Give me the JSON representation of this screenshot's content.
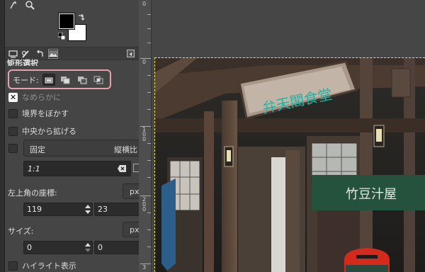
{
  "toolbox": {
    "tool_icons": [
      "path-tool-icon",
      "magnify-icon"
    ],
    "colors": {
      "foreground": "#000000",
      "background": "#ffffff"
    }
  },
  "dock_tabs": [
    "tool-options-icon",
    "paint-dynamics-icon",
    "undo-history-icon",
    "images-icon"
  ],
  "tool_options": {
    "title": "矩形選択",
    "mode_label": "モード:",
    "mode_buttons": [
      "replace",
      "add",
      "subtract",
      "intersect"
    ],
    "antialias_label": "なめらかに",
    "feather_label": "境界をぼかす",
    "expand_from_center_label": "中央から拡げる",
    "fixed_value": "固定",
    "fixed_mode": "縦横比",
    "ratio_value": "1:1",
    "position_label": "左上角の座標:",
    "position_unit": "px",
    "position_x": "119",
    "position_y": "23",
    "size_label": "サイズ:",
    "size_unit": "px",
    "size_w": "0",
    "size_h": "0",
    "highlight_label": "ハイライト表示"
  },
  "ruler": {
    "labels": [
      "0",
      "0",
      "1\n0\n0",
      "2\n0\n0",
      "3"
    ]
  },
  "photo": {
    "sign_text": "弁天閣食堂",
    "curtain_text": "竹豆汁屋"
  }
}
